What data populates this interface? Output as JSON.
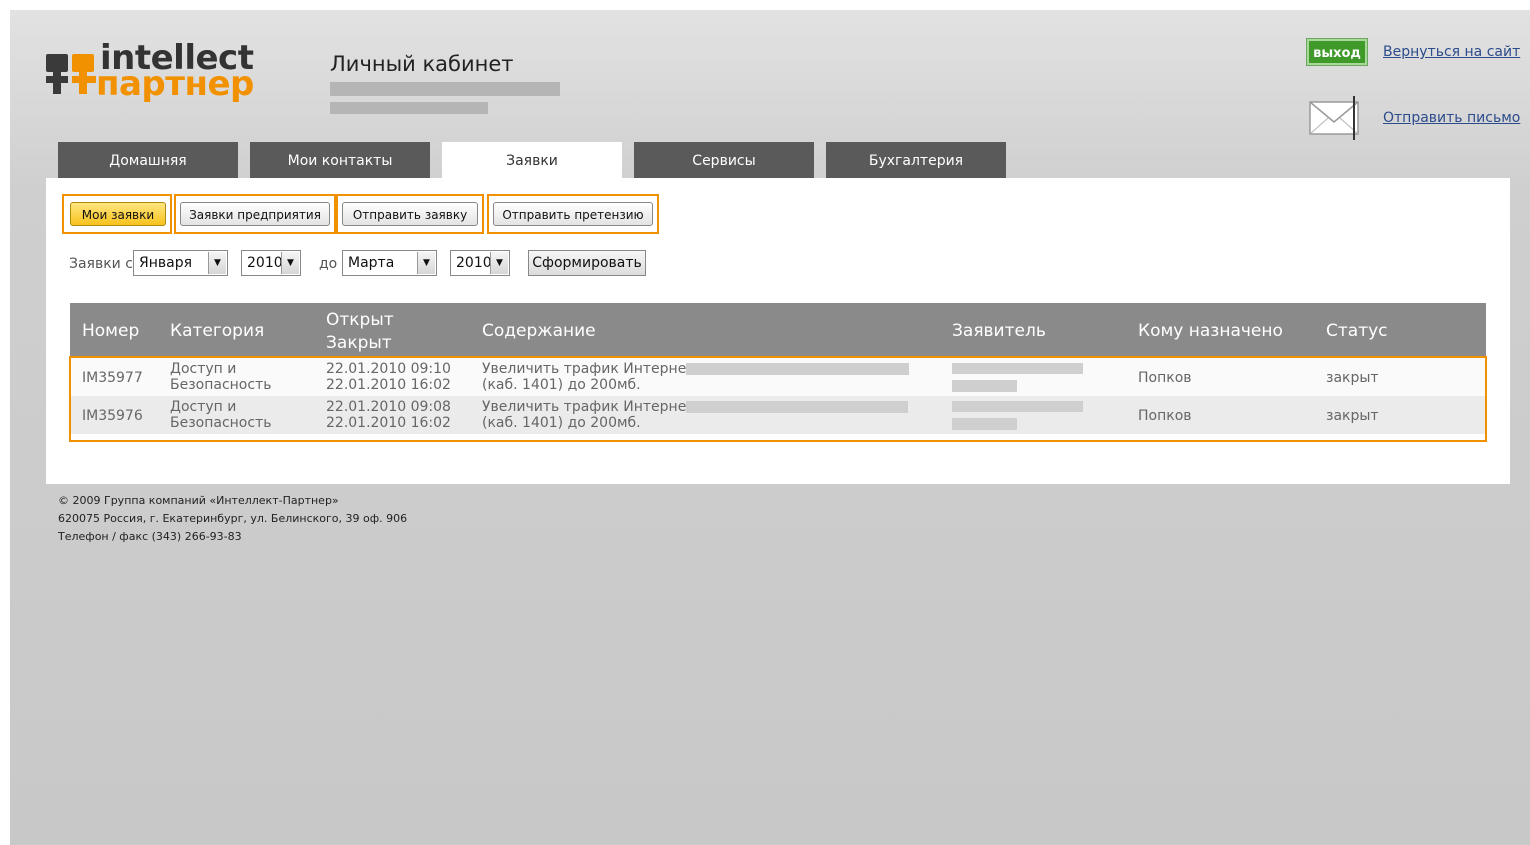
{
  "logo": {
    "word_top": "intellect",
    "word_bottom": "партнер"
  },
  "header": {
    "title": "Личный кабинет",
    "exit_label": "выход",
    "back_link": "Вернуться на сайт",
    "send_link": "Отправить письмо"
  },
  "tabs": [
    {
      "label": "Домашняя",
      "active": false
    },
    {
      "label": "Мои контакты",
      "active": false
    },
    {
      "label": "Заявки",
      "active": true
    },
    {
      "label": "Сервисы",
      "active": false
    },
    {
      "label": "Бухгалтерия",
      "active": false
    }
  ],
  "subnav": [
    {
      "label": "Мои заявки",
      "active": true
    },
    {
      "label": "Заявки предприятия",
      "active": false
    },
    {
      "label": "Отправить заявку",
      "active": false
    },
    {
      "label": "Отправить претензию",
      "active": false
    }
  ],
  "filter": {
    "from_label": "Заявки с",
    "from_month": "Января",
    "from_year": "2010",
    "to_label": "до",
    "to_month": "Марта",
    "to_year": "2010",
    "submit_label": "Сформировать"
  },
  "table": {
    "headers": {
      "number": "Номер",
      "category": "Категория",
      "opened": "Открыт",
      "closed": "Закрыт",
      "content": "Содержание",
      "applicant": "Заявитель",
      "assigned": "Кому назначено",
      "status": "Статус"
    },
    "rows": [
      {
        "number": "IM35977",
        "category_1": "Доступ и",
        "category_2": "Безопасность",
        "opened": "22.01.2010 09:10",
        "closed": "22.01.2010 16:02",
        "content_1": "Увеличить трафик Интернет",
        "content_2": "(каб. 1401) до 200мб.",
        "assigned": "Попков",
        "status": "закрыт"
      },
      {
        "number": "IM35976",
        "category_1": "Доступ и",
        "category_2": "Безопасность",
        "opened": "22.01.2010 09:08",
        "closed": "22.01.2010 16:02",
        "content_1": "Увеличить трафик Интернет",
        "content_2": "(каб. 1401) до 200мб.",
        "assigned": "Попков",
        "status": "закрыт"
      }
    ]
  },
  "footer": {
    "line1": "© 2009 Группа компаний «Интеллект-Партнер»",
    "line2": "620075 Россия, г. Екатеринбург, ул. Белинского, 39 оф. 906",
    "line3": "Телефон / факс (343) 266-93-83"
  },
  "colors": {
    "accent": "#f29100",
    "tab_bg": "#5a5a5a",
    "exit_green": "#3f9a2a",
    "table_header": "#8a8a8a",
    "link": "#2c4c8c"
  },
  "icons": [
    "logo-mark-icon",
    "mail-icon",
    "dropdown-arrow-icon"
  ]
}
